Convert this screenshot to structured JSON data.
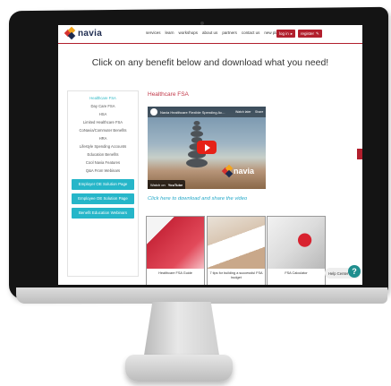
{
  "nav": {
    "logo_text": "navia",
    "links": [
      "services",
      "learn",
      "workshops",
      "about us",
      "partners",
      "contact us",
      "new plan setup"
    ],
    "login_label": "log in",
    "register_label": "register"
  },
  "page": {
    "title": "Click on any benefit below and download what you need!"
  },
  "sidebar": {
    "items": [
      "Healthcare FSA",
      "Day Care FSA",
      "HSA",
      "Limited Healthcare FSA",
      "CoNavia/Commuter Benefits",
      "HRA",
      "Lifestyle Spending Accounts",
      "Education Benefits",
      "Cool Navia Features",
      "Q&A From Webinars"
    ],
    "buttons": [
      "Employer OE Solution Page",
      "Employee OE Solution Page",
      "Benefit Education Webinars"
    ]
  },
  "main": {
    "heading": "Healthcare FSA",
    "video": {
      "title": "Navia Healthcare Flexible Spending Ac...",
      "watch_later": "Watch later",
      "share": "Share",
      "watch_on": "Watch on",
      "youtube": "YouTube",
      "logo_text": "navia"
    },
    "download_link": "Click here to download and share the video",
    "thumbnails": [
      {
        "caption": "Healthcare FSA Guide"
      },
      {
        "caption": "7 tips for building a successful FSA budget"
      },
      {
        "caption": "FSA Calculator"
      }
    ]
  },
  "help": {
    "label": "Help Center",
    "icon_text": "?"
  },
  "colors": {
    "brand_red": "#b21f2d",
    "accent_teal": "#26b6c9",
    "heading_red": "#c2394a"
  }
}
